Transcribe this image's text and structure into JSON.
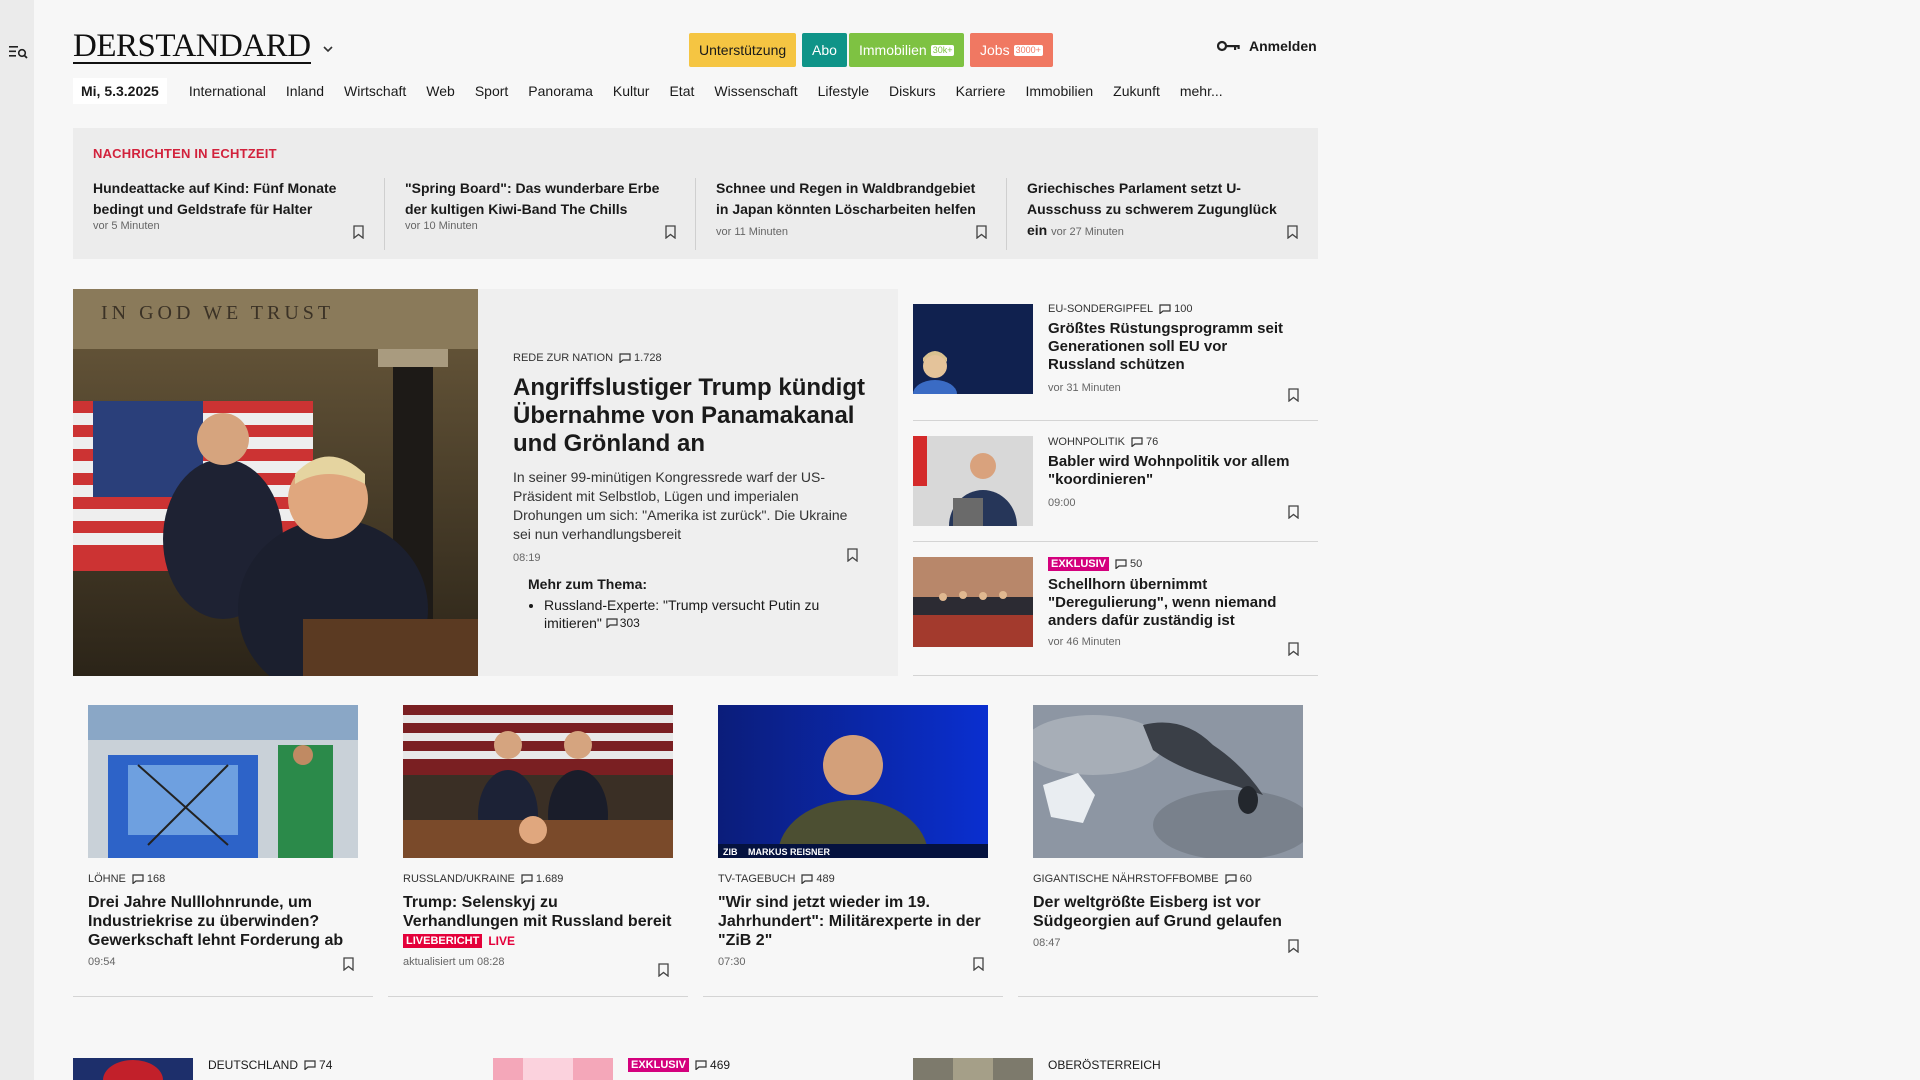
{
  "header": {
    "logo": "DERSTANDARD",
    "promos": [
      {
        "label": "Unterstützung",
        "color": "#f5c542",
        "text_color": "#1a1a1a"
      },
      {
        "label": "Abo",
        "color": "#0f9488",
        "text_color": "#ffffff"
      },
      {
        "label": "Immobilien",
        "pill": "30k+",
        "color": "#7ec242",
        "text_color": "#ffffff"
      },
      {
        "label": "Jobs",
        "pill": "3000+",
        "color": "#f07862",
        "text_color": "#ffffff"
      }
    ],
    "login_label": "Anmelden"
  },
  "nav": {
    "date": "Mi, 5.3.2025",
    "items": [
      "International",
      "Inland",
      "Wirtschaft",
      "Web",
      "Sport",
      "Panorama",
      "Kultur",
      "Etat",
      "Wissenschaft",
      "Lifestyle",
      "Diskurs",
      "Karriere",
      "Immobilien",
      "Zukunft",
      "mehr..."
    ]
  },
  "ticker": {
    "label": "NACHRICHTEN IN ECHTZEIT",
    "items": [
      {
        "title": "Hundeattacke auf Kind: Fünf Monate bedingt und Geldstrafe für Halter",
        "time": "vor 5 Minuten"
      },
      {
        "title": "\"Spring Board\": Das wunderbare Erbe der kultigen Kiwi-Band The Chills",
        "time": "vor 10 Minuten"
      },
      {
        "title": "Schnee und Regen in Waldbrandgebiet in Japan könnten Löscharbeiten helfen",
        "time": "vor 11 Minuten"
      },
      {
        "title": "Griechisches Parlament setzt U-Ausschuss zu schwerem Zugunglück ein",
        "time": "vor 27 Minuten"
      }
    ]
  },
  "hero": {
    "image_caption_text": "IN GOD WE TRUST",
    "kicker": "REDE ZUR NATION",
    "comments": "1.728",
    "title": "Angriffslustiger Trump kündigt Übernahme von Panamakanal und Grönland an",
    "teaser": "In seiner 99-minütigen Kongressrede warf der US-Präsident mit Selbstlob, Lügen und imperialen Drohungen um sich: \"Amerika ist zurück\". Die Ukraine sei nun verhandlungsbereit",
    "time": "08:19",
    "more_label": "Mehr zum Thema:",
    "more_items": [
      {
        "text": "Russland-Experte: \"Trump versucht Putin zu imitieren\"",
        "comments": "303"
      }
    ]
  },
  "side": [
    {
      "kicker": "EU-SONDERGIPFEL",
      "comments": "100",
      "title": "Größtes Rüstungsprogramm seit Generationen soll EU vor Russland schützen",
      "time": "vor 31 Minuten",
      "badge": ""
    },
    {
      "kicker": "WOHNPOLITIK",
      "comments": "76",
      "title": "Babler wird Wohnpolitik vor allem \"koordinieren\"",
      "time": "09:00",
      "badge": ""
    },
    {
      "kicker": "",
      "comments": "50",
      "title": "Schellhorn übernimmt \"Deregulierung\", wenn niemand anders dafür zuständig ist",
      "time": "vor 46 Minuten",
      "badge": "EXKLUSIV"
    }
  ],
  "grid": [
    {
      "kicker": "LÖHNE",
      "comments": "168",
      "title": "Drei Jahre Nulllohnrunde, um Industriekrise zu überwinden? Gewerkschaft lehnt Forderung ab",
      "time": "09:54"
    },
    {
      "kicker": "RUSSLAND/UKRAINE",
      "comments": "1.689",
      "title": "Trump: Selenskyj zu Verhandlungen mit Russland bereit",
      "time": "aktualisiert um 08:28",
      "live_badge": "LIVEBERICHT",
      "live_label": "LIVE"
    },
    {
      "kicker": "TV-TAGEBUCH",
      "comments": "489",
      "title": "\"Wir sind jetzt wieder im 19. Jahrhundert\": Militärexperte in der \"ZiB 2\"",
      "time": "07:30",
      "lower_third": "MARKUS REISNER",
      "lower_third_tag": "ZIB"
    },
    {
      "kicker": "GIGANTISCHE NÄHRSTOFFBOMBE",
      "comments": "60",
      "title": "Der weltgrößte Eisberg ist vor Südgeorgien auf Grund gelaufen",
      "time": "08:47"
    }
  ],
  "bottom": [
    {
      "kicker": "DEUTSCHLAND",
      "comments": "74"
    },
    {
      "badge": "EXKLUSIV",
      "comments": "469"
    },
    {
      "kicker": "OBERÖSTERREICH"
    }
  ],
  "colors": {
    "accent_red": "#d2223c",
    "exklusiv": "#d4007d",
    "live": "#e4003a"
  }
}
